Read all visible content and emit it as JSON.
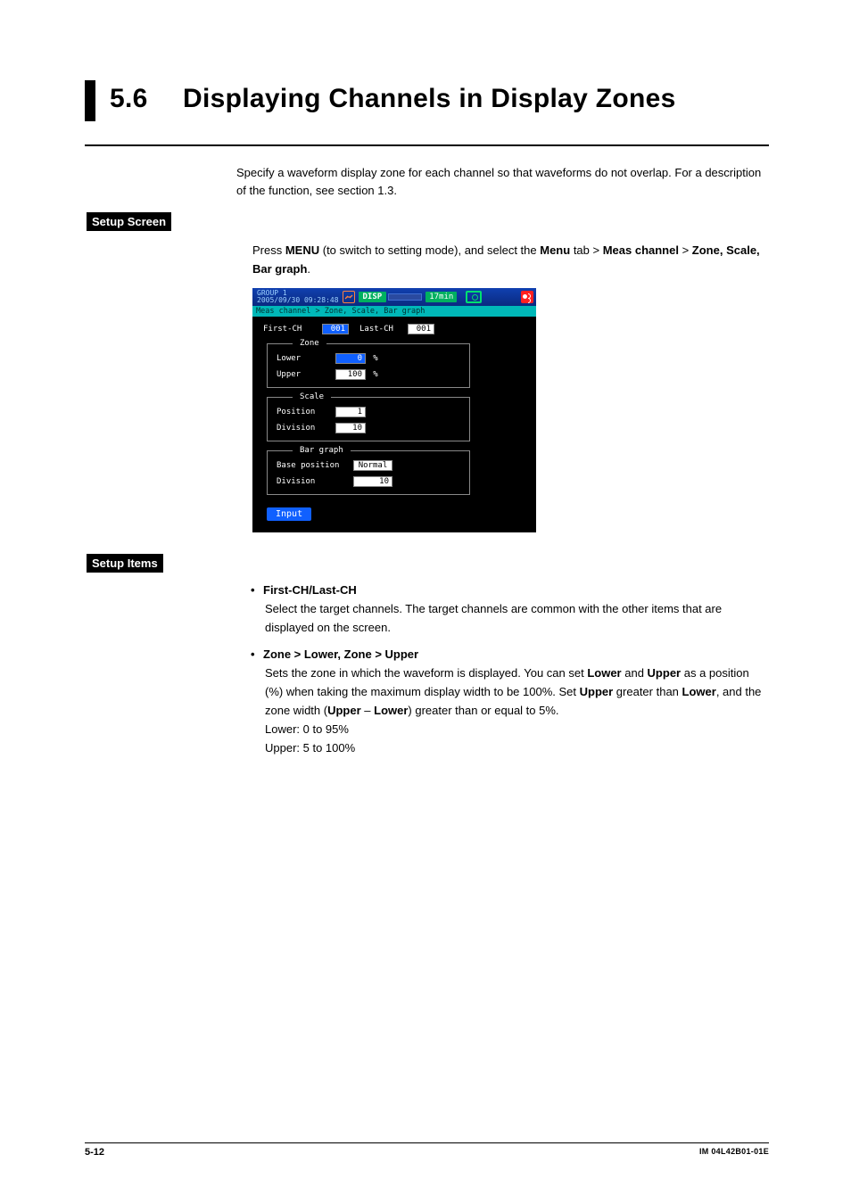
{
  "section_number": "5.6",
  "section_title": "Displaying Channels in Display Zones",
  "intro": "Specify a waveform display zone for each channel so that waveforms do not overlap. For a description of the function, see section 1.3.",
  "tags": {
    "setup_screen": "Setup Screen",
    "setup_items": "Setup Items"
  },
  "setup_screen_text": {
    "press": "Press ",
    "menu1": "MENU",
    "mid1": " (to switch to setting mode), and select the ",
    "menu2": "Menu",
    "mid2": " tab > ",
    "meas": "Meas channel",
    "mid3": " > ",
    "zone": "Zone, Scale, Bar graph",
    "end": "."
  },
  "screenshot": {
    "group_label": "GROUP 1",
    "datetime": "2005/09/30 09:28:48",
    "disp": "DISP",
    "interval": "17min",
    "crumb": "Meas channel > Zone, Scale, Bar graph",
    "first_ch_label": "First-CH",
    "first_ch_value": "001",
    "last_ch_label": "Last-CH",
    "last_ch_value": "001",
    "zone_label": "Zone",
    "zone_lower_label": "Lower",
    "zone_lower_value": "0",
    "zone_upper_label": "Upper",
    "zone_upper_value": "100",
    "percent": "%",
    "scale_label": "Scale",
    "scale_position_label": "Position",
    "scale_position_value": "1",
    "scale_division_label": "Division",
    "scale_division_value": "10",
    "bar_label": "Bar graph",
    "bar_base_label": "Base position",
    "bar_base_value": "Normal",
    "bar_division_label": "Division",
    "bar_division_value": "10",
    "input_btn": "Input"
  },
  "items": {
    "first_last": {
      "title": "First-CH/Last-CH",
      "body": "Select the target channels. The target channels are common with the other items that are displayed on the screen."
    },
    "zone": {
      "title": "Zone > Lower, Zone > Upper",
      "body_1": "Sets the zone in which the waveform is displayed. You can set ",
      "b1": "Lower",
      "body_2": " and ",
      "b2": "Upper",
      "body_3": " as a position (%) when taking the maximum display width to be 100%. Set ",
      "b3": "Upper",
      "body_4": " greater than ",
      "b4": "Lower",
      "body_5": ", and the zone width (",
      "b5": "Upper",
      "body_6": " – ",
      "b6": "Lower",
      "body_7": ") greater than or equal to 5%.",
      "lower_range": "Lower:  0 to 95%",
      "upper_range": "Upper:  5 to 100%"
    }
  },
  "footer": {
    "page": "5-12",
    "doc": "IM 04L42B01-01E"
  }
}
